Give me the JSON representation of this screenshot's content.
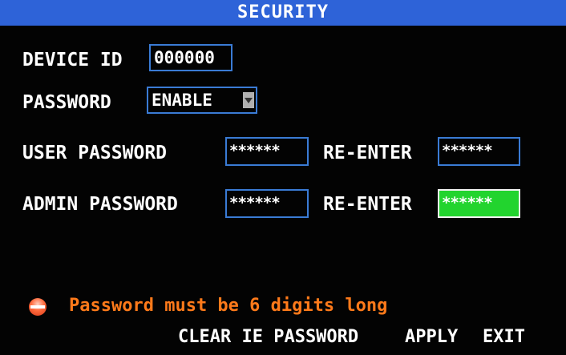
{
  "window": {
    "title": "SECURITY"
  },
  "form": {
    "device_id": {
      "label": "DEVICE ID",
      "value": "000000"
    },
    "password_mode": {
      "label": "PASSWORD",
      "value": "ENABLE",
      "arrow_icon": "chevron-down-icon"
    },
    "user_password": {
      "label": "USER PASSWORD",
      "value": "******",
      "reenter_label": "RE-ENTER",
      "reenter_value": "******"
    },
    "admin_password": {
      "label": "ADMIN PASSWORD",
      "value": "******",
      "reenter_label": "RE-ENTER",
      "reenter_value": "******"
    }
  },
  "status": {
    "icon": "warning-icon",
    "message": "Password must be 6 digits long"
  },
  "buttons": {
    "clear_ie_password": "CLEAR IE PASSWORD",
    "apply": "APPLY",
    "exit": "EXIT"
  },
  "colors": {
    "title_bar": "#2e63d8",
    "background": "#030303",
    "field_border": "#3a7bd5",
    "focused_field": "#22d42e",
    "warning_text": "#ff7a1a"
  }
}
